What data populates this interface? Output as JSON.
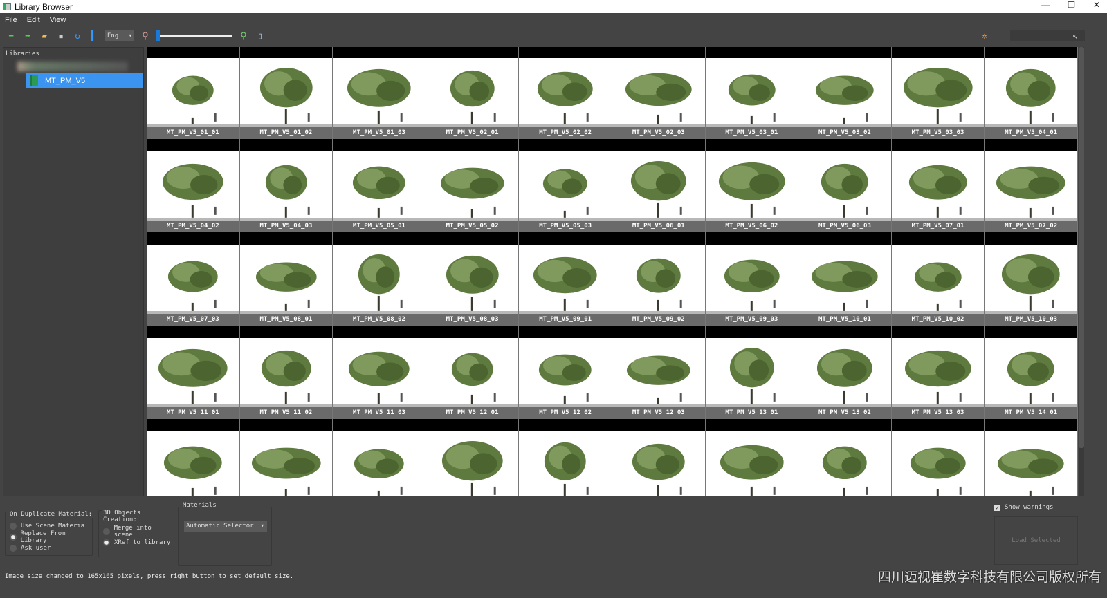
{
  "window": {
    "title": "Library Browser",
    "controls": [
      "—",
      "❐",
      "✕"
    ]
  },
  "menu": [
    "File",
    "Edit",
    "View"
  ],
  "toolbar": {
    "language": "Eng"
  },
  "zoom_slider": {
    "value_percent": 0
  },
  "sidebar": {
    "header": "Libraries",
    "selected_library": "MT_PM_V5"
  },
  "grid": {
    "labels": [
      "MT_PM_V5_01_01",
      "MT_PM_V5_01_02",
      "MT_PM_V5_01_03",
      "MT_PM_V5_02_01",
      "MT_PM_V5_02_02",
      "MT_PM_V5_02_03",
      "MT_PM_V5_03_01",
      "MT_PM_V5_03_02",
      "MT_PM_V5_03_03",
      "MT_PM_V5_04_01",
      "MT_PM_V5_04_02",
      "MT_PM_V5_04_03",
      "MT_PM_V5_05_01",
      "MT_PM_V5_05_02",
      "MT_PM_V5_05_03",
      "MT_PM_V5_06_01",
      "MT_PM_V5_06_02",
      "MT_PM_V5_06_03",
      "MT_PM_V5_07_01",
      "MT_PM_V5_07_02",
      "MT_PM_V5_07_03",
      "MT_PM_V5_08_01",
      "MT_PM_V5_08_02",
      "MT_PM_V5_08_03",
      "MT_PM_V5_09_01",
      "MT_PM_V5_09_02",
      "MT_PM_V5_09_03",
      "MT_PM_V5_10_01",
      "MT_PM_V5_10_02",
      "MT_PM_V5_10_03",
      "MT_PM_V5_11_01",
      "MT_PM_V5_11_02",
      "MT_PM_V5_11_03",
      "MT_PM_V5_12_01",
      "MT_PM_V5_12_02",
      "MT_PM_V5_12_03",
      "MT_PM_V5_13_01",
      "MT_PM_V5_13_02",
      "MT_PM_V5_13_03",
      "MT_PM_V5_14_01"
    ],
    "extra_unlabeled": 10
  },
  "duplicate": {
    "title": "On Duplicate Material:",
    "options": [
      "Use Scene Material",
      "Replace From Library",
      "Ask user"
    ],
    "selected": 1
  },
  "creation": {
    "title": "3D Objects Creation:",
    "options": [
      "Merge into scene",
      "XRef to library"
    ],
    "selected": 1
  },
  "materials": {
    "title": "Materials",
    "selector": "Automatic Selector"
  },
  "show_warnings": {
    "label": "Show warnings",
    "checked": true
  },
  "load_button": "Load Selected",
  "status": "Image size changed to 165x165 pixels, press right button to set default size.",
  "watermark": "四川迈视崔数字科技有限公司版权所有",
  "colors": {
    "accent": "#3a94f0",
    "bg": "#444444"
  }
}
